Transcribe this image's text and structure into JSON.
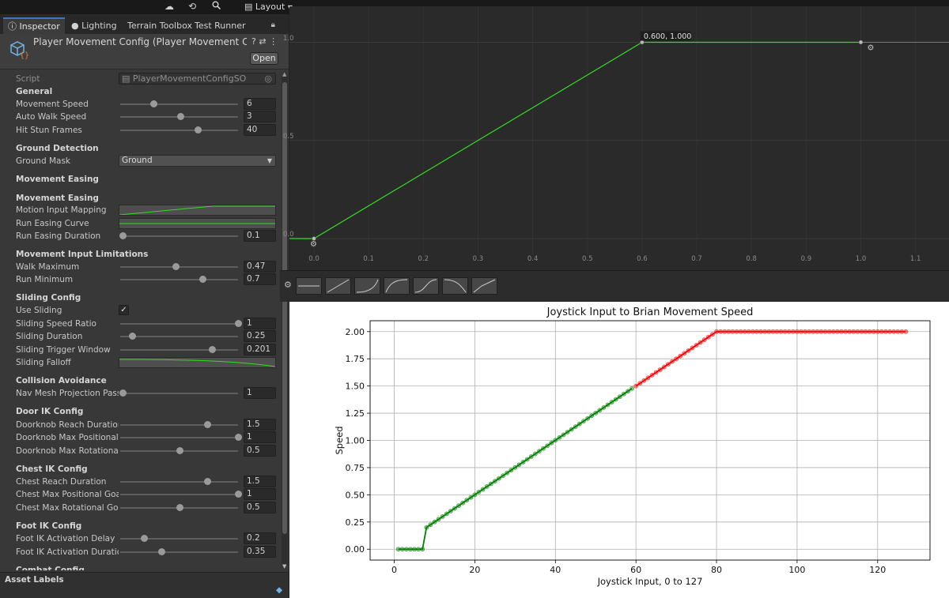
{
  "topbar": {
    "layout_label": "Layout",
    "cloud_icon": "cloud-icon",
    "history_icon": "history-icon",
    "search_icon": "search-icon"
  },
  "tabs": [
    {
      "label": "Inspector",
      "icon": "info-icon"
    },
    {
      "label": "Lighting",
      "icon": "bulb-icon"
    },
    {
      "label": "Terrain Toolbox"
    },
    {
      "label": "Test Runner"
    }
  ],
  "asset": {
    "title": "Player Movement Config (Player Movement Config SO)",
    "open_label": "Open"
  },
  "script": {
    "label": "Script",
    "value": "PlayerMovementConfigSO"
  },
  "sections": {
    "general": "General",
    "ground_detection": "Ground Detection",
    "movement_easing_1": "Movement Easing",
    "movement_easing_2": "Movement Easing",
    "movement_input_limitations": "Movement Input Limitations",
    "sliding_config": "Sliding Config",
    "collision_avoidance": "Collision Avoidance",
    "door_ik_config": "Door IK Config",
    "chest_ik_config": "Chest IK Config",
    "foot_ik_config": "Foot IK Config",
    "combat_config": "Combat Config"
  },
  "fields": {
    "movement_speed": {
      "label": "Movement Speed",
      "value": "6",
      "fraction": 0.28
    },
    "auto_walk_speed": {
      "label": "Auto Walk Speed",
      "value": "3",
      "fraction": 0.51
    },
    "hit_stun_frames": {
      "label": "Hit Stun Frames",
      "value": "40",
      "fraction": 0.66
    },
    "ground_mask": {
      "label": "Ground Mask",
      "value": "Ground"
    },
    "motion_input_mapping": {
      "label": "Motion Input Mapping"
    },
    "run_easing_curve": {
      "label": "Run Easing Curve"
    },
    "run_easing_duration": {
      "label": "Run Easing Duration",
      "value": "0.1",
      "fraction": 0.02
    },
    "walk_maximum": {
      "label": "Walk Maximum",
      "value": "0.47",
      "fraction": 0.47
    },
    "run_minimum": {
      "label": "Run Minimum",
      "value": "0.7",
      "fraction": 0.7
    },
    "use_sliding": {
      "label": "Use Sliding",
      "checked": true
    },
    "sliding_speed_ratio": {
      "label": "Sliding Speed Ratio",
      "value": "1",
      "fraction": 1.0
    },
    "sliding_duration": {
      "label": "Sliding Duration",
      "value": "0.25",
      "fraction": 0.1
    },
    "sliding_trigger_window": {
      "label": "Sliding Trigger Window",
      "value": "0.201",
      "fraction": 0.78
    },
    "sliding_falloff": {
      "label": "Sliding Falloff"
    },
    "nav_mesh_projection_passes": {
      "label": "Nav Mesh Projection Passes",
      "value": "1",
      "fraction": 0.02
    },
    "doorknob_reach_duration": {
      "label": "Doorknob Reach Duration",
      "value": "1.5",
      "fraction": 0.74
    },
    "doorknob_max_positional_goal": {
      "label": "Doorknob Max Positional Goal",
      "value": "1",
      "fraction": 1.0
    },
    "doorknob_max_rotational_goal": {
      "label": "Doorknob Max Rotational Goal",
      "value": "0.5",
      "fraction": 0.5
    },
    "chest_reach_duration": {
      "label": "Chest Reach Duration",
      "value": "1.5",
      "fraction": 0.74
    },
    "chest_max_positional_goal": {
      "label": "Chest Max Positional Goal",
      "value": "1",
      "fraction": 1.0
    },
    "chest_max_rotational_goal": {
      "label": "Chest Max Rotational Goal",
      "value": "0.5",
      "fraction": 0.5
    },
    "foot_ik_activation_delay": {
      "label": "Foot IK Activation Delay",
      "value": "0.2",
      "fraction": 0.2
    },
    "foot_ik_activation_duration": {
      "label": "Foot IK Activation Duration",
      "value": "0.35",
      "fraction": 0.35
    }
  },
  "asset_labels": "Asset Labels",
  "curve_editor": {
    "y_ticks": [
      "1.0",
      "0.5",
      "0.0"
    ],
    "x_ticks": [
      "0.0",
      "0.1",
      "0.2",
      "0.3",
      "0.4",
      "0.5",
      "0.6",
      "0.7",
      "0.8",
      "0.9",
      "1.0",
      "1.1"
    ],
    "keys": [
      [
        0.0,
        0.0
      ],
      [
        0.6,
        1.0
      ],
      [
        1.0,
        1.0
      ]
    ],
    "key_label": "0.600, 1.000",
    "curve_color": "#33dd22"
  },
  "chart_data": {
    "type": "line",
    "title": "Joystick Input to Brian Movement Speed",
    "xlabel": "Joystick Input, 0 to 127",
    "ylabel": "Speed",
    "xlim": [
      -6,
      133
    ],
    "ylim": [
      -0.1,
      2.1
    ],
    "x_ticks": [
      0,
      20,
      40,
      60,
      80,
      100,
      120
    ],
    "y_ticks": [
      "0.00",
      "0.25",
      "0.50",
      "0.75",
      "1.00",
      "1.25",
      "1.50",
      "1.75",
      "2.00"
    ],
    "grid": true,
    "series": [
      {
        "color": "#008000",
        "x_range": [
          1,
          59
        ],
        "segments": [
          [
            1,
            0.0
          ],
          [
            7,
            0.0
          ],
          [
            8,
            0.2
          ],
          [
            59,
            1.477
          ]
        ]
      },
      {
        "color": "#ff0000",
        "x_range": [
          60,
          127
        ],
        "segments": [
          [
            60,
            1.5
          ],
          [
            80,
            2.0
          ],
          [
            127,
            2.0
          ]
        ]
      }
    ]
  }
}
